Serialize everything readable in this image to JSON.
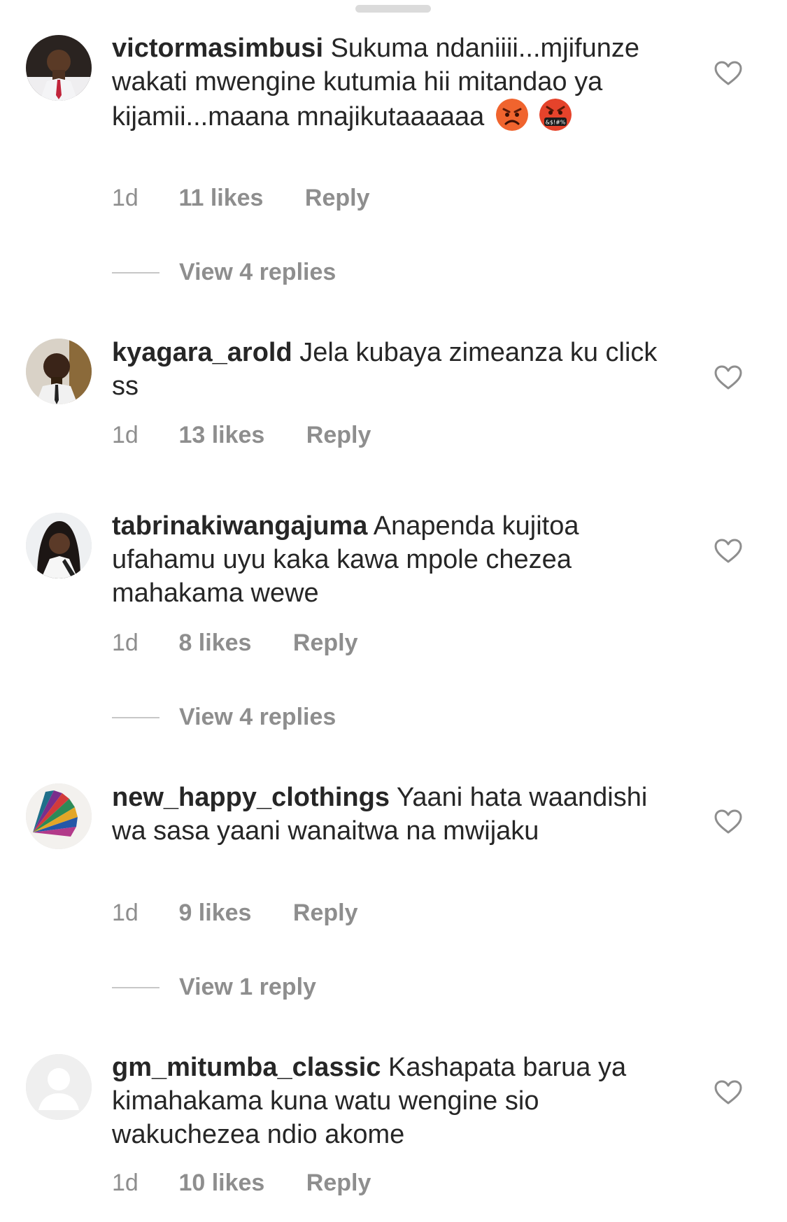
{
  "comments": [
    {
      "username": "victormasimbusi",
      "text": "Sukuma ndaniiii...mjifunze wakati mwengine kutumia hii mitandao ya kijamii...maana mnajikutaaaaaa",
      "emojis": [
        "angry-face-icon",
        "swearing-face-icon"
      ],
      "time": "1d",
      "likes": "11 likes",
      "reply": "Reply",
      "view_replies": "View 4 replies"
    },
    {
      "username": "kyagara_arold",
      "text": "Jela kubaya zimeanza ku click ss",
      "time": "1d",
      "likes": "13 likes",
      "reply": "Reply"
    },
    {
      "username": "tabrinakiwangajuma",
      "text": "Anapenda kujitoa ufahamu uyu kaka kawa mpole chezea mahakama wewe",
      "time": "1d",
      "likes": "8 likes",
      "reply": "Reply",
      "view_replies": "View 4 replies"
    },
    {
      "username": "new_happy_clothings",
      "text": "Yaani hata waandishi wa sasa yaani wanaitwa na mwijaku",
      "time": "1d",
      "likes": "9 likes",
      "reply": "Reply",
      "view_replies": "View 1 reply"
    },
    {
      "username": "gm_mitumba_classic",
      "text": "Kashapata barua ya kimahakama kuna watu wengine sio wakuchezea ndio akome",
      "time": "1d",
      "likes": "10 likes",
      "reply": "Reply"
    }
  ],
  "colors": {
    "text": "#262626",
    "secondary": "#8e8e8e",
    "divider": "#c7c7c7"
  }
}
